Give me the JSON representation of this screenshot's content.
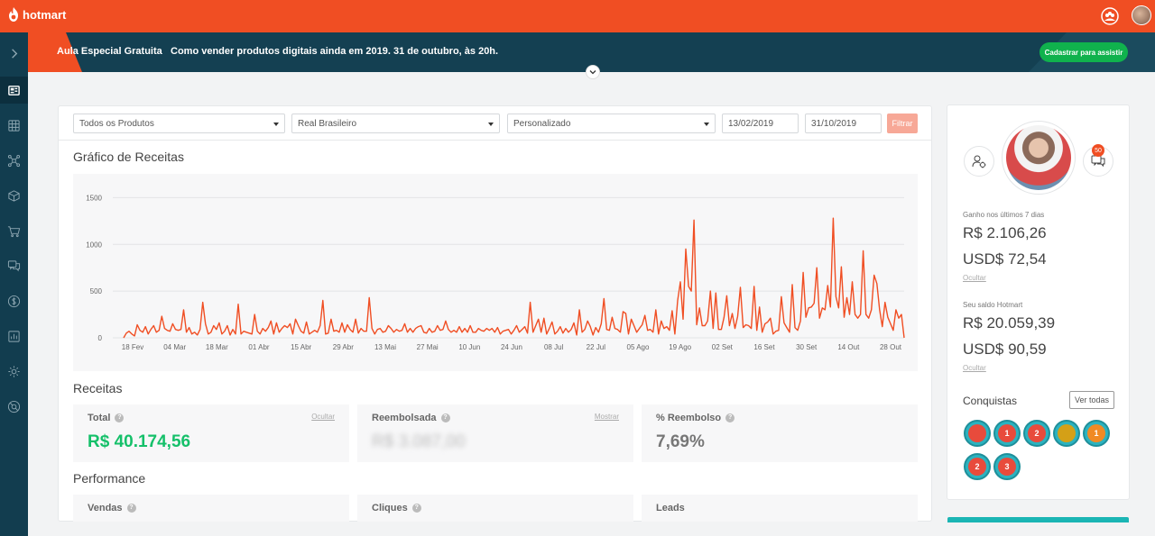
{
  "brand": {
    "name": "hotmart",
    "accent": "#f04e23",
    "sidebar_color": "#123d4f"
  },
  "banner": {
    "title": "Aula Especial Gratuita",
    "text": "Como vender produtos digitais ainda em 2019. 31 de outubro, às 20h.",
    "button": "Cadastrar para assistir"
  },
  "sidebar": {
    "items": [
      {
        "icon": "chevron-right-icon"
      },
      {
        "icon": "dashboard-icon"
      },
      {
        "icon": "apps-grid-icon"
      },
      {
        "icon": "network-icon"
      },
      {
        "icon": "cube-icon"
      },
      {
        "icon": "cart-icon"
      },
      {
        "icon": "chat-icon"
      },
      {
        "icon": "dollar-icon"
      },
      {
        "icon": "bar-chart-icon"
      },
      {
        "icon": "settings-icon"
      },
      {
        "icon": "help-circle-icon"
      }
    ]
  },
  "filters": {
    "product": "Todos os Produtos",
    "currency": "Real Brasileiro",
    "period": "Personalizado",
    "date_from": "13/02/2019",
    "date_to": "31/10/2019",
    "button": "Filtrar"
  },
  "sections": {
    "chart_title": "Gráfico de Receitas",
    "revenue_title": "Receitas",
    "performance_title": "Performance"
  },
  "revenue": {
    "total_label": "Total",
    "total_link": "Ocultar",
    "total_value": "R$ 40.174,56",
    "refund_label": "Reembolsada",
    "refund_link": "Mostrar",
    "refund_value": "R$ 3.087,00",
    "refund_pct_label": "% Reembolso",
    "refund_pct_value": "7,69%"
  },
  "performance": {
    "sales_label": "Vendas",
    "clicks_label": "Cliques",
    "leads_label": "Leads"
  },
  "profile": {
    "earned_label": "Ganho nos últimos 7 dias",
    "earned_brl": "R$ 2.106,26",
    "earned_usd": "USD$ 72,54",
    "earned_hide": "Ocultar",
    "balance_label": "Seu saldo Hotmart",
    "balance_brl": "R$ 20.059,39",
    "balance_usd": "USD$ 90,59",
    "balance_hide": "Ocultar",
    "notifications": "50",
    "achievements_title": "Conquistas",
    "see_all": "Ver todas",
    "medals": [
      {
        "label": "",
        "color": "#e84b3c"
      },
      {
        "label": "1",
        "color": "#e84b3c"
      },
      {
        "label": "2",
        "color": "#e84b3c"
      },
      {
        "label": "",
        "color": "#d4a017"
      },
      {
        "label": "1",
        "color": "#f08a24"
      },
      {
        "label": "2",
        "color": "#e84b3c"
      },
      {
        "label": "3",
        "color": "#e84b3c"
      }
    ]
  },
  "chart_data": {
    "type": "line",
    "color": "#f04e23",
    "x_ticks": [
      "18 Fev",
      "04 Mar",
      "18 Mar",
      "01 Abr",
      "15 Abr",
      "29 Abr",
      "13 Mai",
      "27 Mai",
      "10 Jun",
      "24 Jun",
      "08 Jul",
      "22 Jul",
      "05 Ago",
      "19 Ago",
      "02 Set",
      "16 Set",
      "30 Set",
      "14 Out",
      "28 Out"
    ],
    "y_ticks": [
      0,
      500,
      1000,
      1500
    ],
    "ylim": [
      0,
      1600
    ],
    "x_start": "13/02/2019",
    "x_end": "31/10/2019",
    "values": [
      0,
      50,
      70,
      40,
      20,
      140,
      80,
      60,
      120,
      40,
      90,
      130,
      60,
      80,
      230,
      100,
      80,
      70,
      150,
      90,
      80,
      90,
      300,
      60,
      110,
      40,
      60,
      30,
      90,
      380,
      150,
      40,
      60,
      130,
      90,
      160,
      40,
      70,
      130,
      30,
      90,
      40,
      360,
      40,
      70,
      60,
      50,
      40,
      250,
      70,
      40,
      100,
      70,
      110,
      180,
      40,
      160,
      60,
      100,
      130,
      110,
      150,
      40,
      200,
      130,
      70,
      50,
      170,
      40,
      60,
      80,
      60,
      130,
      400,
      40,
      50,
      200,
      70,
      80,
      60,
      160,
      60,
      140,
      90,
      60,
      200,
      50,
      100,
      70,
      70,
      430,
      100,
      40,
      90,
      100,
      60,
      70,
      130,
      100,
      60,
      90,
      70,
      80,
      150,
      60,
      100,
      60,
      100,
      120,
      130,
      60,
      50,
      100,
      60,
      70,
      130,
      80,
      90,
      180,
      90,
      60,
      80,
      60,
      120,
      60,
      100,
      60,
      130,
      60,
      60,
      100,
      80,
      70,
      100,
      80,
      100,
      60,
      110,
      40,
      70,
      80,
      90,
      40,
      80,
      130,
      60,
      90,
      120,
      50,
      380,
      60,
      130,
      200,
      60,
      210,
      40,
      100,
      170,
      40,
      70,
      120,
      50,
      100,
      60,
      90,
      160,
      30,
      300,
      60,
      90,
      180,
      120,
      30,
      110,
      60,
      150,
      420,
      90,
      80,
      220,
      100,
      90,
      60,
      280,
      260,
      40,
      200,
      130,
      60,
      100,
      140,
      240,
      80,
      90,
      60,
      300,
      40,
      180,
      100,
      120,
      80,
      290,
      40,
      400,
      600,
      200,
      950,
      550,
      500,
      1260,
      140,
      320,
      130,
      130,
      180,
      500,
      100,
      480,
      90,
      90,
      220,
      450,
      130,
      260,
      100,
      230,
      540,
      110,
      140,
      130,
      100,
      550,
      80,
      330,
      60,
      150,
      170,
      210,
      40,
      70,
      80,
      440,
      160,
      110,
      60,
      570,
      110,
      80,
      180,
      700,
      220,
      320,
      330,
      370,
      750,
      210,
      320,
      300,
      560,
      330,
      1280,
      440,
      320,
      760,
      220,
      430,
      250,
      600,
      250,
      210,
      250,
      930,
      250,
      210,
      300,
      670,
      580,
      300,
      120,
      380,
      220,
      150,
      80,
      300,
      210,
      250,
      0
    ]
  }
}
